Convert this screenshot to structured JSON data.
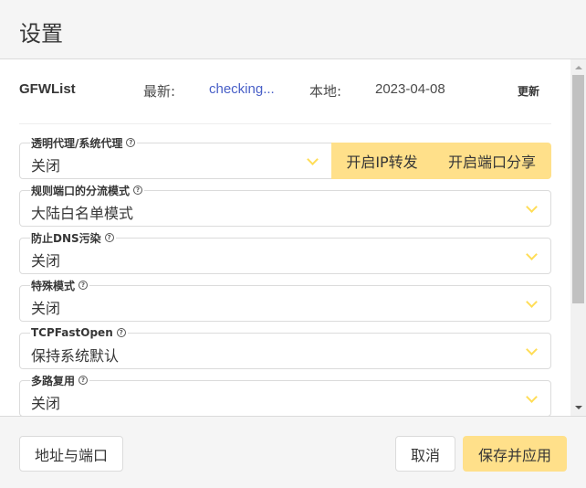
{
  "header": {
    "title": "设置"
  },
  "gfwlist": {
    "label": "GFWList",
    "latest_label": "最新:",
    "latest_value": "checking...",
    "local_label": "本地:",
    "local_value": "2023-04-08",
    "update_label": "更新"
  },
  "fields": {
    "proxy": {
      "label": "透明代理/系统代理",
      "value": "关闭",
      "ip_forward_label": "开启IP转发",
      "port_share_label": "开启端口分享"
    },
    "routing": {
      "label": "规则端口的分流模式",
      "value": "大陆白名单模式"
    },
    "dns": {
      "label": "防止DNS污染",
      "value": "关闭"
    },
    "special": {
      "label": "特殊模式",
      "value": "关闭"
    },
    "tfo": {
      "label": "TCPFastOpen",
      "value": "保持系统默认"
    },
    "mux": {
      "label": "多路复用",
      "value": "关闭"
    }
  },
  "help_glyph": "?",
  "footer": {
    "address_port_label": "地址与端口",
    "cancel_label": "取消",
    "save_apply_label": "保存并应用"
  },
  "colors": {
    "accent": "#ffe08a",
    "chevron": "#ffdd57",
    "link": "#485fc7"
  },
  "icons": {
    "help": "question-circle-icon",
    "dropdown": "chevron-down-icon"
  }
}
